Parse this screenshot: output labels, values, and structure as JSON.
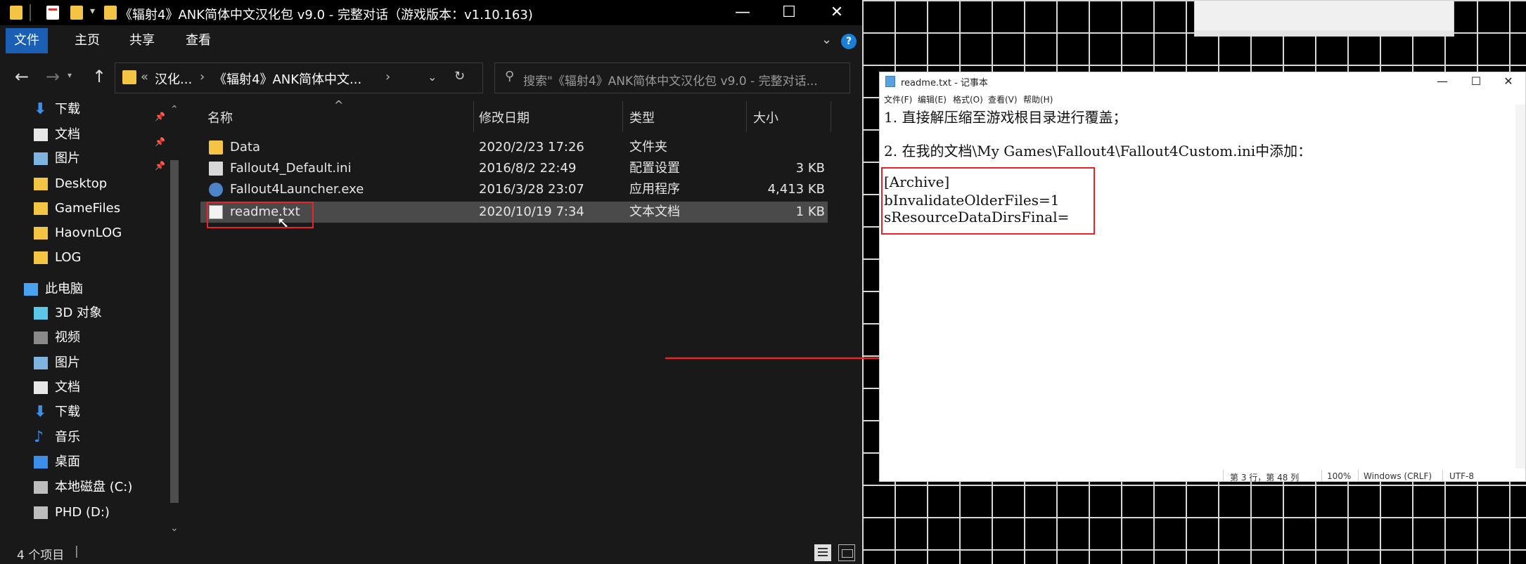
{
  "explorer": {
    "window_title": "《辐射4》ANK简体中文汉化包 v9.0 - 完整对话（游戏版本：v1.10.163)",
    "window_controls": {
      "minimize": "—",
      "maximize": "☐",
      "close": "✕"
    },
    "ribbon_tabs": [
      "文件",
      "主页",
      "共享",
      "查看"
    ],
    "address": {
      "overflow": "«",
      "crumbs": [
        "汉化...",
        "《辐射4》ANK简体中文..."
      ]
    },
    "search_placeholder": "搜索\"《辐射4》ANK简体中文汉化包 v9.0 - 完整对话...",
    "sidebar_items": [
      {
        "label": "下载",
        "icon": "download-arrow-icon",
        "pinned": true
      },
      {
        "label": "文档",
        "icon": "document-icon",
        "pinned": true
      },
      {
        "label": "图片",
        "icon": "picture-icon",
        "pinned": true
      },
      {
        "label": "Desktop",
        "icon": "folder-icon",
        "pinned": false
      },
      {
        "label": "GameFiles",
        "icon": "folder-icon",
        "pinned": false
      },
      {
        "label": "HaovnLOG",
        "icon": "folder-icon",
        "pinned": false
      },
      {
        "label": "LOG",
        "icon": "folder-icon",
        "pinned": false
      },
      {
        "label": "此电脑",
        "icon": "computer-icon",
        "pinned": false
      },
      {
        "label": "3D 对象",
        "icon": "cube-icon",
        "pinned": false
      },
      {
        "label": "视频",
        "icon": "video-icon",
        "pinned": false
      },
      {
        "label": "图片",
        "icon": "picture-icon",
        "pinned": false
      },
      {
        "label": "文档",
        "icon": "document-icon",
        "pinned": false
      },
      {
        "label": "下载",
        "icon": "download-arrow-icon",
        "pinned": false
      },
      {
        "label": "音乐",
        "icon": "music-note-icon",
        "pinned": false
      },
      {
        "label": "桌面",
        "icon": "desktop-icon",
        "pinned": false
      },
      {
        "label": "本地磁盘 (C:)",
        "icon": "drive-icon",
        "pinned": false
      },
      {
        "label": "PHD (D:)",
        "icon": "drive-icon",
        "pinned": false
      }
    ],
    "columns": {
      "name": "名称",
      "date": "修改日期",
      "type": "类型",
      "size": "大小"
    },
    "files": [
      {
        "name": "Data",
        "date": "2020/2/23 17:26",
        "type": "文件夹",
        "size": "",
        "icon": "folder-icon"
      },
      {
        "name": "Fallout4_Default.ini",
        "date": "2016/8/2 22:49",
        "type": "配置设置",
        "size": "3 KB",
        "icon": "settings-file-icon"
      },
      {
        "name": "Fallout4Launcher.exe",
        "date": "2016/3/28 23:07",
        "type": "应用程序",
        "size": "4,413 KB",
        "icon": "app-icon"
      },
      {
        "name": "readme.txt",
        "date": "2020/10/19 7:34",
        "type": "文本文档",
        "size": "1 KB",
        "icon": "text-file-icon"
      }
    ],
    "status_text": "4 个项目"
  },
  "notepad": {
    "title": "readme.txt - 记事本",
    "menu": [
      "文件(F)",
      "编辑(E)",
      "格式(O)",
      "查看(V)",
      "帮助(H)"
    ],
    "lines": [
      "1. 直接解压缩至游戏根目录进行覆盖；",
      "",
      "2. 在我的文档\\My Games\\Fallout4\\Fallout4Custom.ini中添加：",
      "",
      "[Archive]",
      "bInvalidateOlderFiles=1",
      "sResourceDataDirsFinal="
    ],
    "status": {
      "position": "第 3 行，第 48 列",
      "zoom": "100%",
      "line_ending": "Windows (CRLF)",
      "encoding": "UTF-8"
    },
    "controls": {
      "minimize": "—",
      "maximize": "☐",
      "close": "✕"
    }
  },
  "colors": {
    "annotation_red": "#e8232a",
    "ribbon_accent": "#1a5fb4",
    "folder_yellow": "#f4c445"
  }
}
